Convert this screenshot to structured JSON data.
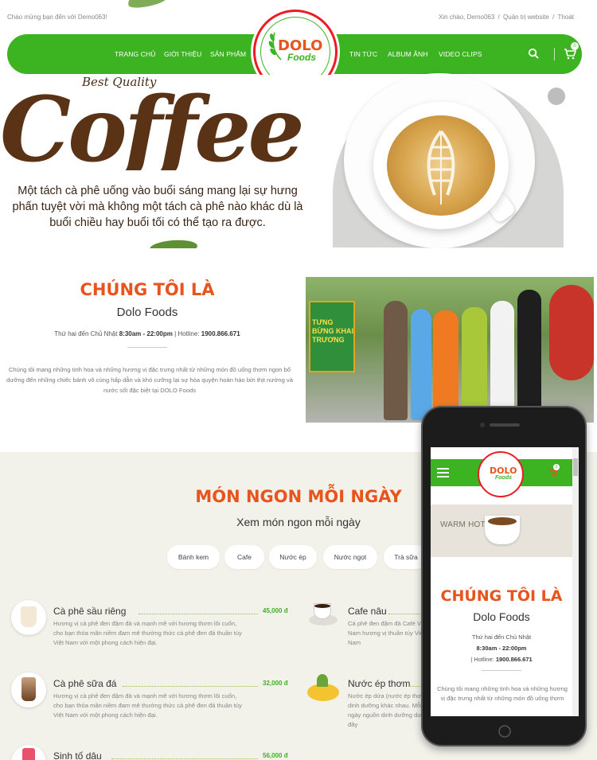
{
  "topbar": {
    "welcome": "Chào mừng bạn đến với Demo063!",
    "greeting": "Xin chào, Demo063",
    "admin_link": "Quản trị website",
    "logout_link": "Thoát",
    "sep": "/"
  },
  "nav": {
    "items_left": [
      "TRANG CHỦ",
      "GIỚI THIỆU",
      "SẢN PHẨM"
    ],
    "items_right": [
      "TIN TỨC",
      "ALBUM ẢNH",
      "VIDEO CLIPS"
    ],
    "cart_count": "0",
    "icons": {
      "search": "search-icon",
      "cart": "cart-icon"
    },
    "color": "#3cb321"
  },
  "logo": {
    "brand": "DOLO",
    "sub": "Foods"
  },
  "hero": {
    "best_quality": "Best Quality",
    "headline": "Coffee",
    "tagline": "Một tách cà phê uống vào buổi sáng mang lại sự hưng phấn tuyệt vời mà không một tách cà phê nào khác dù là buổi chiều hay buổi tối có thể tạo ra được."
  },
  "about": {
    "title": "CHÚNG TÔI LÀ",
    "brand": "Dolo Foods",
    "hours_prefix": "Thứ hai đến Chủ Nhật",
    "hours_time": "8:30am - 22:00pm",
    "hotline_prefix": "| Hotline:",
    "hotline": "1900.866.671",
    "description": "Chúng tôi mang những tinh hoa và những hương vị đặc trưng nhất từ những món đồ uống thơm ngon bổ dưỡng đến những chiếc bánh vô cùng hấp dẫn và khó cưỡng lại sự hòa quyện hoàn hảo bởi thịt nướng và nước sốt đặc biệt tại DOLO Foods",
    "photo_banner_text": "TƯNG BỪNG KHAI TRƯƠNG"
  },
  "menu": {
    "title": "MÓN NGON MỖI NGÀY",
    "subtitle": "Xem món ngon mỗi ngày",
    "tabs": [
      "Bánh kem",
      "Cafe",
      "Nước ép",
      "Nước ngọt",
      "Trà sữa"
    ],
    "dishes_left": [
      {
        "name": "Cà phê sầu riêng",
        "price": "45,000 đ",
        "desc": "Hương vị cà phê đen đậm đà và mạnh mẽ với hương thơm lôi cuốn, cho bạn thỏa mãn niềm đam mê thưởng thức cà phê đen đá thuần túy Việt Nam với một phong cách hiện đại."
      },
      {
        "name": "Cà phê sữa đá",
        "price": "32,000 đ",
        "desc": "Hương vị cà phê đen đậm đà và mạnh mẽ với hương thơm lôi cuốn, cho bạn thỏa mãn niềm đam mê thưởng thức cà phê đen đá thuần túy Việt Nam với một phong cách hiện đại."
      },
      {
        "name": "Sinh tố dâu",
        "price": "56,000 đ",
        "desc": ""
      }
    ],
    "dishes_right": [
      {
        "name": "Cafe nâu",
        "desc": "Cà phê đen đậm đà Café Việt Nam hương vị thuần túy Việt Nam"
      },
      {
        "name": "Nước ép thơm",
        "desc": "Nước ép dứa (nước ép thơm) dinh dưỡng khác nhau. Mỗi ngày nguồn dinh dưỡng dưới đây"
      }
    ]
  },
  "mobile": {
    "banner": "WARM HOT DRINKS",
    "title": "CHÚNG TÔI LÀ",
    "brand": "Dolo Foods",
    "hours_prefix": "Thứ hai đến Chủ Nhật",
    "hours_time": "8:30am - 22:00pm",
    "hotline_prefix": "| Hotline:",
    "hotline": "1900.866.671",
    "description": "Chúng tôi mang những tinh hoa và những hương vị đặc trưng nhất từ những món đồ uống thơm",
    "cart_count": "0",
    "logo_brand": "DOLO",
    "logo_sub": "Foods"
  }
}
